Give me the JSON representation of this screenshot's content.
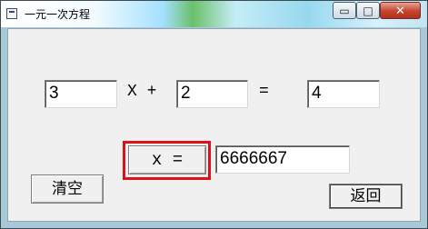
{
  "window": {
    "title": "一元一次方程",
    "min_glyph": "▭",
    "max_glyph": "□",
    "close_glyph": "✕",
    "icons": [
      "app-icon",
      "minimize-icon",
      "maximize-icon",
      "close-icon"
    ]
  },
  "equation": {
    "a_value": "3",
    "x_plus_label": "X +",
    "b_value": "2",
    "equals_label": "=",
    "c_value": "4"
  },
  "result": {
    "calc_button_label": "x =",
    "value": "6666667"
  },
  "buttons": {
    "clear_label": "清空",
    "back_label": "返回"
  },
  "colors": {
    "highlight": "#e0101a",
    "close_button": "#c4432e"
  }
}
